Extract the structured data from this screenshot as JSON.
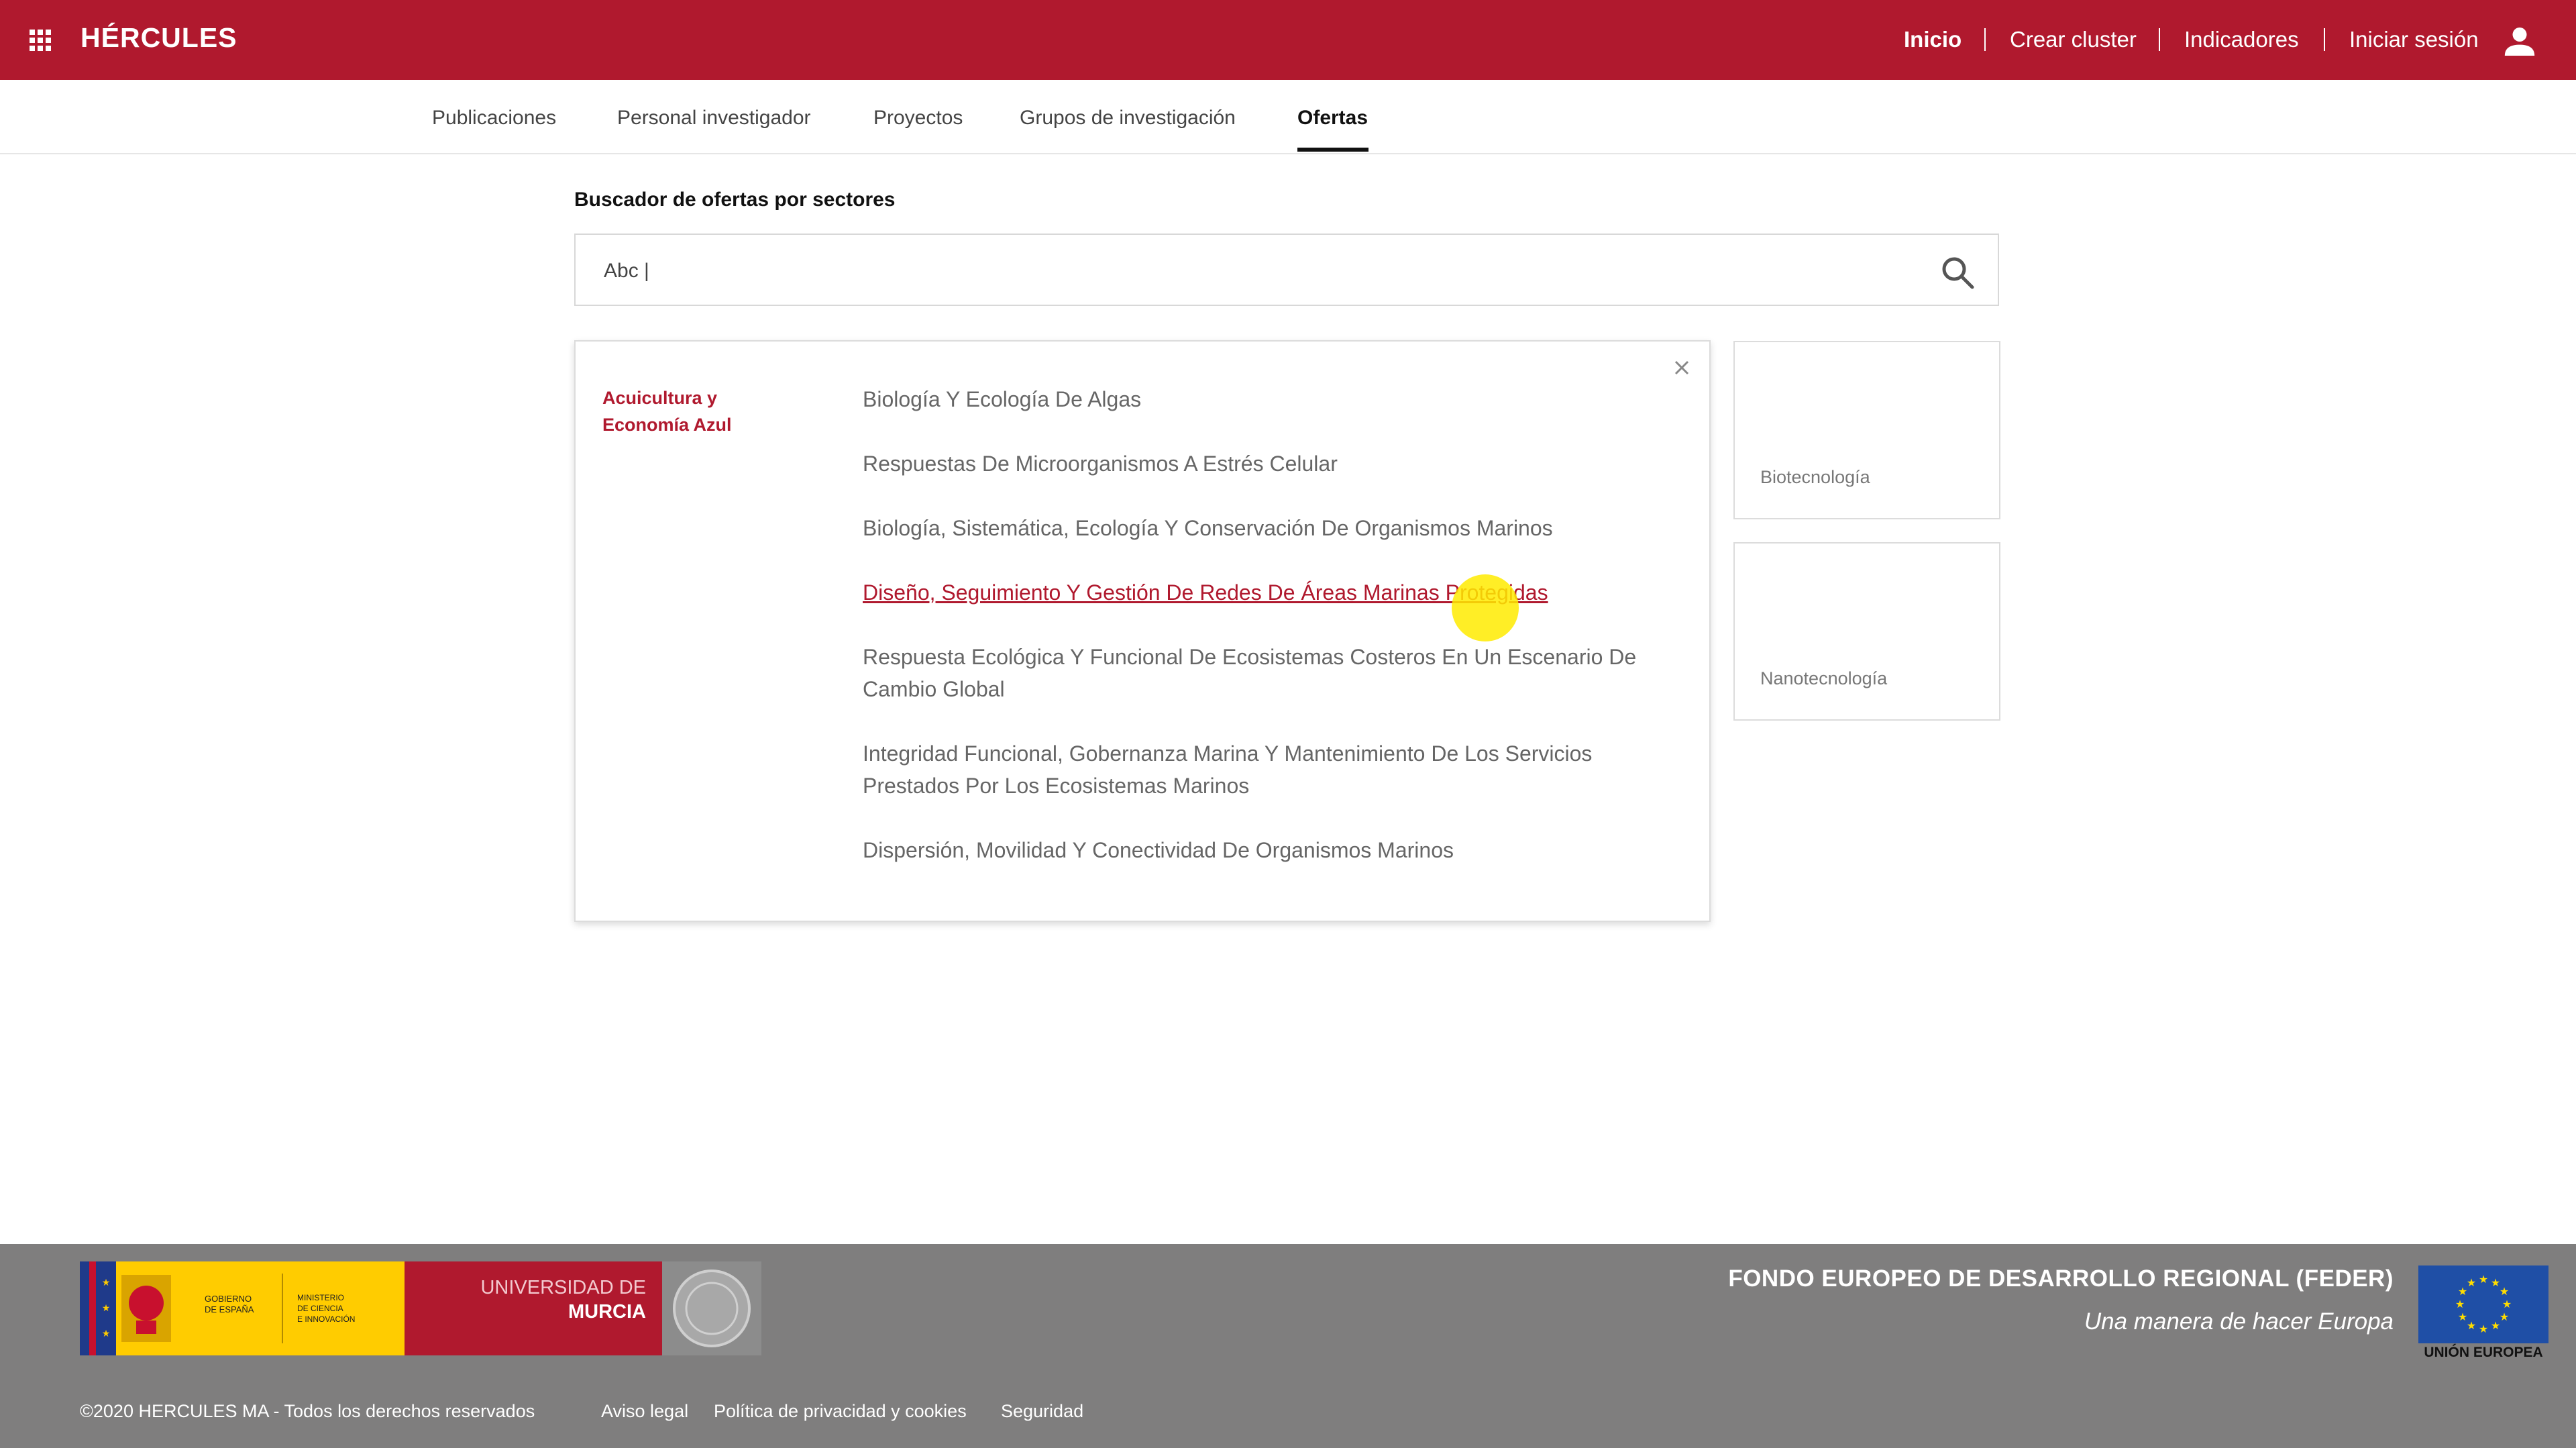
{
  "header": {
    "brand": "HÉRCULES",
    "nav": [
      "Inicio",
      "Crear cluster",
      "Indicadores",
      "Iniciar sesión"
    ]
  },
  "tabs": [
    "Publicaciones",
    "Personal investigador",
    "Proyectos",
    "Grupos de investigación",
    "Ofertas"
  ],
  "active_tab": "Ofertas",
  "search": {
    "title": "Buscador de ofertas por sectores",
    "value": "Abc |"
  },
  "panel": {
    "sector": "Acuicultura y Economía Azul",
    "subsectors": [
      "Biología Y Ecología De Algas",
      "Respuestas De Microorganismos A Estrés Celular",
      "Biología, Sistemática, Ecología Y Conservación De Organismos Marinos",
      "Diseño, Seguimiento Y Gestión De Redes De Áreas Marinas Protegidas",
      "Respuesta Ecológica Y Funcional De Ecosistemas Costeros En Un Escenario De Cambio Global",
      "Integridad Funcional, Gobernanza Marina Y Mantenimiento De Los Servicios Prestados Por Los Ecosistemas Marinos",
      "Dispersión, Movilidad Y Conectividad De Organismos Marinos"
    ],
    "highlighted_index": 3
  },
  "cards": [
    "Biotecnología",
    "Nanotecnología"
  ],
  "footer": {
    "logo_texts": {
      "gobierno": "GOBIERNO DE ESPAÑA",
      "ministerio": "MINISTERIO DE CIENCIA E INNOVACIÓN",
      "universidad_line1": "UNIVERSIDAD DE",
      "universidad_line2": "MURCIA"
    },
    "feder_title": "FONDO EUROPEO DE DESARROLLO REGIONAL (FEDER)",
    "feder_sub": "Una manera de hacer Europa",
    "eu_label": "UNIÓN EUROPEA",
    "copyright": "©2020 HERCULES MA  - Todos los derechos reservados",
    "links": [
      "Aviso legal",
      "Política de privacidad y cookies",
      "Seguridad"
    ]
  },
  "colors": {
    "brand_red": "#b0192e",
    "footer_gray": "#7f7e7e",
    "eu_blue": "#1f4fa6",
    "highlight_yellow": "#ffeb00"
  },
  "icons": [
    "apps-grid-icon",
    "user-icon",
    "search-icon",
    "close-icon",
    "eu-flag-icon"
  ]
}
